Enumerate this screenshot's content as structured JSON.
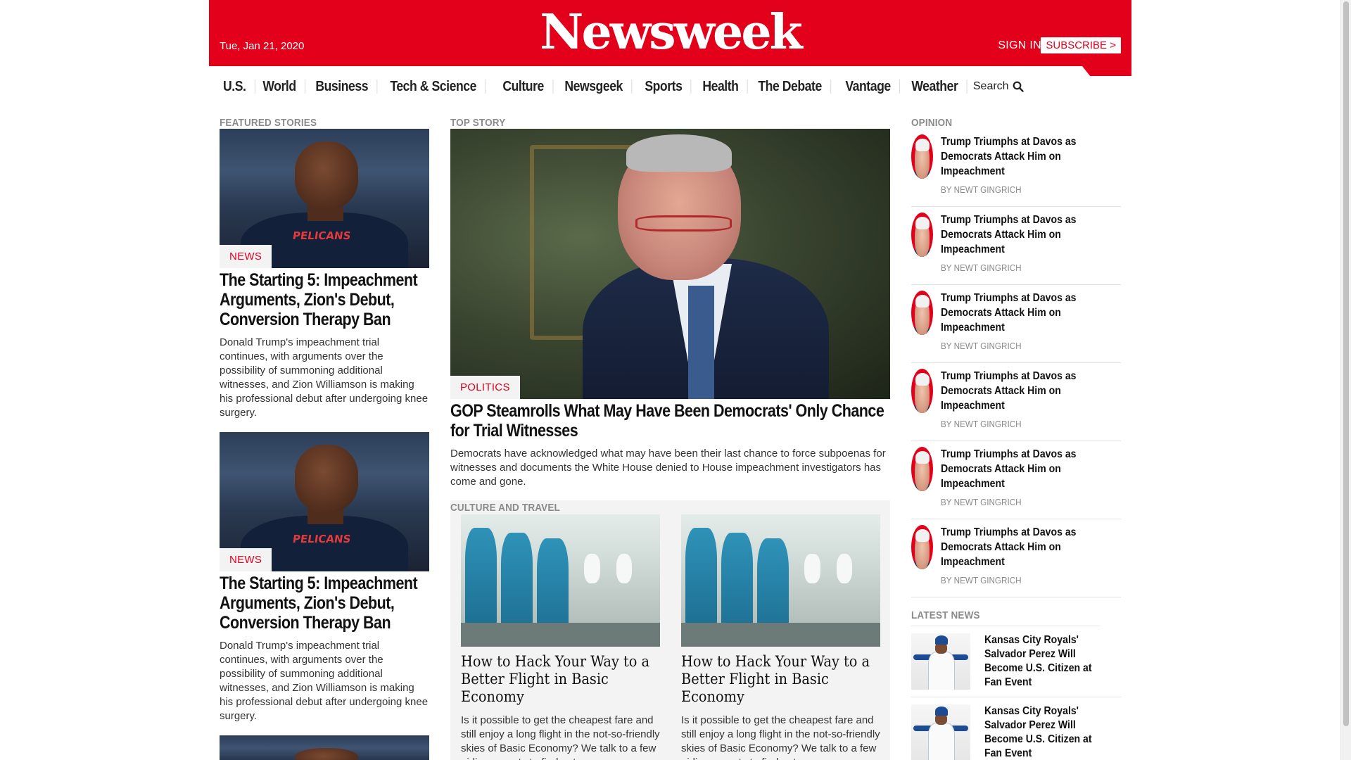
{
  "header": {
    "date": "Tue, Jan 21, 2020",
    "logo": "Newsweek",
    "sign_in": "SIGN IN",
    "subscribe": "SUBSCRIBE >"
  },
  "nav": {
    "items": [
      "U.S.",
      "World",
      "Business",
      "Tech & Science",
      "Culture",
      "Newsgeek",
      "Sports",
      "Health",
      "The Debate",
      "Vantage",
      "Weather"
    ],
    "search": "Search"
  },
  "featured": {
    "label": "FEATURED STORIES",
    "stories": [
      {
        "tag": "NEWS",
        "title": "The Starting 5: Impeachment Arguments, Zion's Debut, Conversion Therapy Ban",
        "summary": "Donald Trump's impeachment trial continues, with arguments over the possibility of summoning additional witnesses, and Zion Williamson is making his professional debut after undergoing knee surgery."
      },
      {
        "tag": "NEWS",
        "title": "The Starting 5: Impeachment Arguments, Zion's Debut, Conversion Therapy Ban",
        "summary": "Donald Trump's impeachment trial continues, with arguments over the possibility of summoning additional witnesses, and Zion Williamson is making his professional debut after undergoing knee surgery."
      }
    ]
  },
  "top_story": {
    "label": "TOP STORY",
    "tag": "POLITICS",
    "title": "GOP Steamrolls What May Have Been Democrats' Only Chance for Trial Witnesses",
    "summary": "Democrats have acknowledged what may have been their last chance to force subpoenas for witnesses and documents the White House denied to House impeachment investigators has come and gone."
  },
  "culture_travel": {
    "label": "CULTURE AND TRAVEL",
    "cards": [
      {
        "title": "How to Hack Your Way to a Better Flight in Basic Economy",
        "summary": "Is it possible to get the cheapest fare and still enjoy a long flight in the not-so-friendly skies of Basic Economy? We talk to a few airline experts to find out."
      },
      {
        "title": "How to Hack Your Way to a Better Flight in Basic Economy",
        "summary": "Is it possible to get the cheapest fare and still enjoy a long flight in the not-so-friendly skies of Basic Economy? We talk to a few airline experts to find out."
      }
    ]
  },
  "opinion": {
    "label": "OPINION",
    "items": [
      {
        "title": "Trump Triumphs at Davos as Democrats Attack Him on Impeachment",
        "byline": "BY NEWT GINGRICH"
      },
      {
        "title": "Trump Triumphs at Davos as Democrats Attack Him on Impeachment",
        "byline": "BY NEWT GINGRICH"
      },
      {
        "title": "Trump Triumphs at Davos as Democrats Attack Him on Impeachment",
        "byline": "BY NEWT GINGRICH"
      },
      {
        "title": "Trump Triumphs at Davos as Democrats Attack Him on Impeachment",
        "byline": "BY NEWT GINGRICH"
      },
      {
        "title": "Trump Triumphs at Davos as Democrats Attack Him on Impeachment",
        "byline": "BY NEWT GINGRICH"
      },
      {
        "title": "Trump Triumphs at Davos as Democrats Attack Him on Impeachment",
        "byline": "BY NEWT GINGRICH"
      }
    ]
  },
  "latest": {
    "label": "LATEST NEWS",
    "items": [
      {
        "title": "Kansas City Royals' Salvador Perez Will Become U.S. Citizen at Fan Event"
      },
      {
        "title": "Kansas City Royals' Salvador Perez Will Become U.S. Citizen at Fan Event"
      }
    ]
  },
  "colors": {
    "brand_red": "#e3001b",
    "label_gray": "#8a8a8a"
  }
}
